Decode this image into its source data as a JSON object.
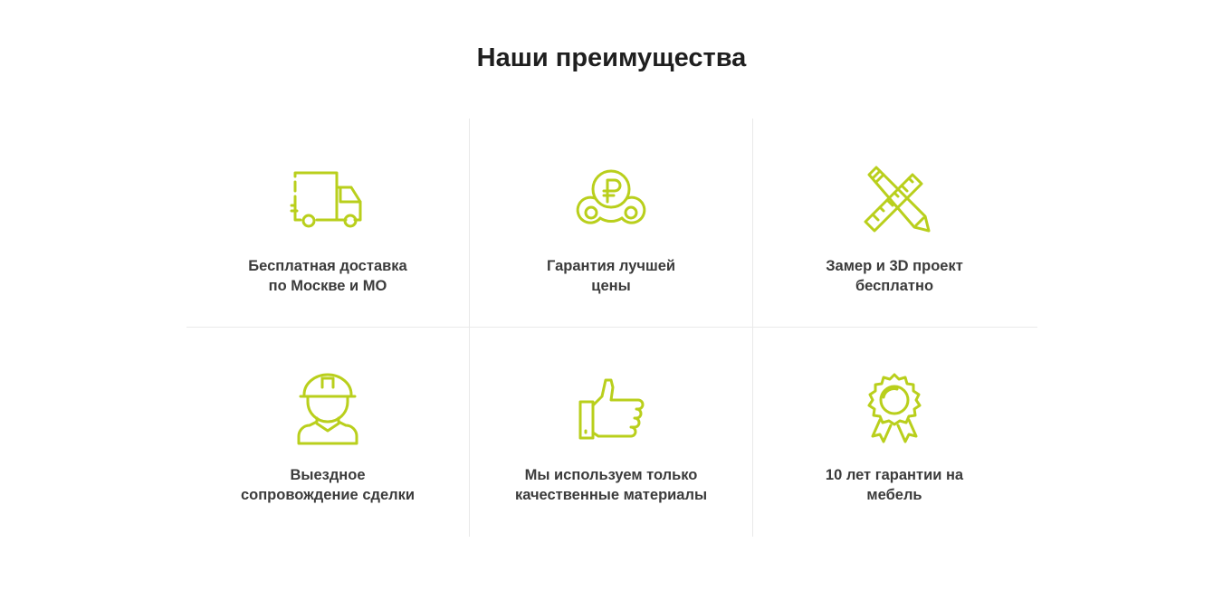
{
  "section": {
    "title": "Наши преимущества"
  },
  "colors": {
    "accent": "#b9cf1c",
    "divider": "#e9e9e9",
    "title": "#1f1f1f",
    "text": "#3b3b3b"
  },
  "features": [
    {
      "icon": "delivery-truck-icon",
      "line1": "Бесплатная доставка",
      "line2": "по Москве и МО"
    },
    {
      "icon": "ruble-coins-icon",
      "line1": "Гарантия лучшей",
      "line2": "цены"
    },
    {
      "icon": "ruler-pencil-icon",
      "line1": "Замер и 3D проект",
      "line2": "бесплатно"
    },
    {
      "icon": "worker-helmet-icon",
      "line1": "Выездное",
      "line2": "сопровождение сделки"
    },
    {
      "icon": "thumbs-up-icon",
      "line1": "Мы используем только",
      "line2": "качественные материалы"
    },
    {
      "icon": "award-medal-icon",
      "line1": "10 лет гарантии на",
      "line2": "мебель"
    }
  ]
}
